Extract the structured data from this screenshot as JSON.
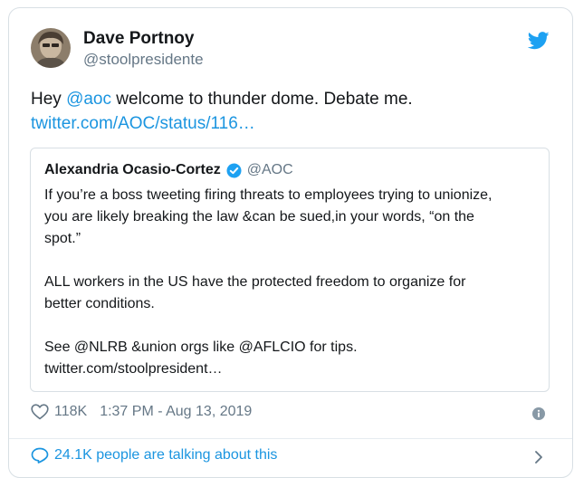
{
  "author": {
    "name": "Dave Portnoy",
    "handle": "@stoolpresidente"
  },
  "tweet": {
    "text_before": "Hey ",
    "mention": "@aoc",
    "text_after": " welcome to thunder dome.   Debate me.",
    "link": "twitter.com/AOC/status/116…"
  },
  "quoted_tweet": {
    "name": "Alexandria Ocasio-Cortez",
    "handle": "@AOC",
    "lines_p1": [
      "If you’re a boss tweeting firing threats to employees trying to unionize,",
      "you are likely breaking the law &can be sued,in your words, “on the",
      "spot.”"
    ],
    "lines_p2": [
      "ALL workers in the US have the protected freedom to organize for",
      "better conditions."
    ],
    "lines_p3": [
      "See @NLRB &union orgs like @AFLCIO for tips.",
      "twitter.com/stoolpresident…"
    ]
  },
  "footer": {
    "likes": "118K",
    "timestamp": "1:37 PM - Aug 13, 2019"
  },
  "conversation": {
    "text": "24.1K people are talking about this"
  },
  "colors": {
    "link_blue": "#1b95e0",
    "twitter_blue": "#1da1f2",
    "secondary_text": "#657786",
    "border": "#d8dfe4"
  },
  "icons": [
    "avatar",
    "twitter-bird-icon",
    "verified-badge-icon",
    "heart-icon",
    "info-icon",
    "speech-bubble-icon",
    "chevron-right-icon"
  ]
}
